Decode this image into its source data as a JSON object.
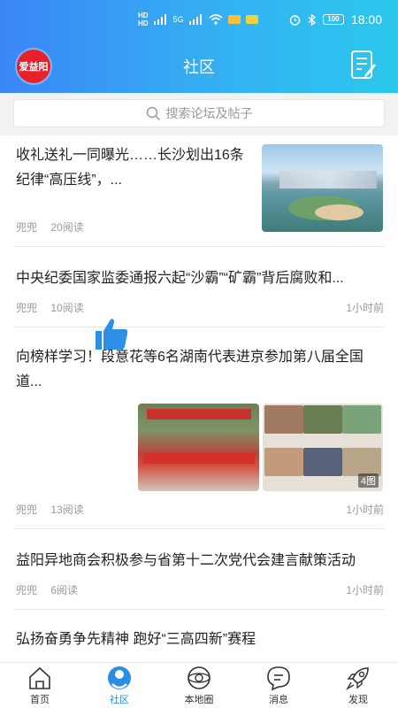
{
  "status_bar": {
    "network_tags": [
      "HD",
      "HD"
    ],
    "signal": "5G",
    "battery": "100",
    "time": "18:00"
  },
  "header": {
    "logo_text": "爱益阳",
    "title": "社区",
    "compose_icon": "compose-icon"
  },
  "search": {
    "placeholder": "搜索论坛及帖子",
    "icon": "search-icon"
  },
  "posts": [
    {
      "title_line1": "收礼送礼一同曝光……长沙划出16条",
      "title_line2": "纪律“高压线”，...",
      "author": "兜兜",
      "reads": "20阅读",
      "time": "",
      "thumbnail": "city-skyline-photo"
    },
    {
      "title_line1": "中央纪委国家监委通报六起“沙霸”“矿霸”背后腐败和...",
      "author": "兜兜",
      "reads": "10阅读",
      "time": "1小时前"
    },
    {
      "title_line1": "向榜样学习！段意花等6名湖南代表进京参加第八届全国",
      "title_line2": "道...",
      "author": "兜兜",
      "reads": "13阅读",
      "time": "1小时前",
      "image_count": "4图"
    },
    {
      "title_line1": "益阳异地商会积极参与省第十二次党代会建言献策活动",
      "author": "兜兜",
      "reads": "6阅读",
      "time": "1小时前"
    },
    {
      "title_line1": "弘扬奋勇争先精神 跑好“三高四新”赛程"
    }
  ],
  "tabbar": {
    "tabs": [
      {
        "label": "首页",
        "icon": "home-icon",
        "active": false
      },
      {
        "label": "社区",
        "icon": "community-icon",
        "active": true
      },
      {
        "label": "本地圈",
        "icon": "local-circle-icon",
        "active": false
      },
      {
        "label": "消息",
        "icon": "message-icon",
        "active": false
      },
      {
        "label": "发现",
        "icon": "rocket-icon",
        "active": false
      }
    ]
  },
  "colors": {
    "header_gradient_start": "#3a86f6",
    "header_gradient_end": "#2bc7ee",
    "accent": "#2b8ce6",
    "logo_red": "#e8202a"
  }
}
